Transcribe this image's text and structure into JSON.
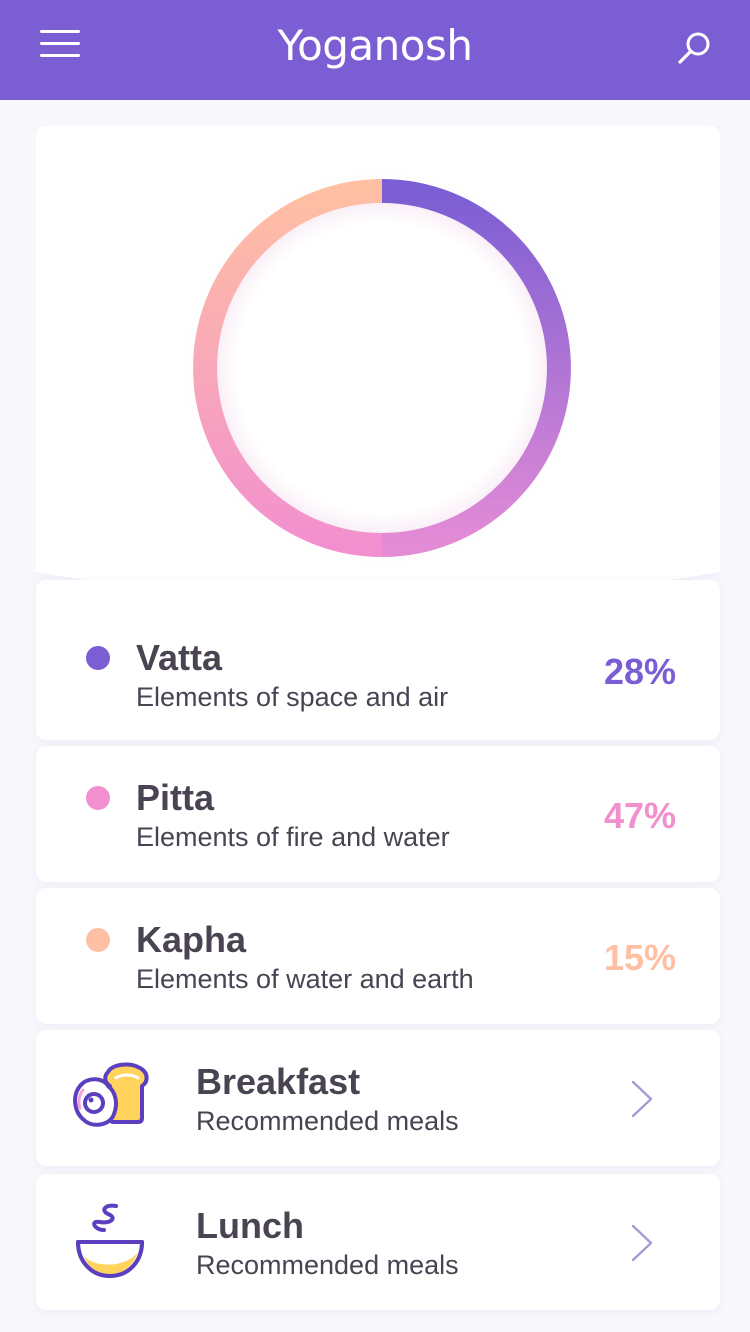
{
  "app": {
    "title": "Yoganosh"
  },
  "icons": {
    "menu": "hamburger-menu-icon",
    "search": "search-icon",
    "chevron": "chevron-right-icon"
  },
  "colors": {
    "brand": "#7b5ed3",
    "vatta": "#7b5ed3",
    "pitta": "#f28fcf",
    "kapha": "#ffbfa3",
    "chevron": "#a59ad6"
  },
  "doshas": [
    {
      "name": "Vatta",
      "description": "Elements of space and air",
      "percent_label": "28%",
      "percent": 28,
      "color": "#7b5ed3"
    },
    {
      "name": "Pitta",
      "description": "Elements of fire and water",
      "percent_label": "47%",
      "percent": 47,
      "color": "#f28fcf"
    },
    {
      "name": "Kapha",
      "description": "Elements of water and earth",
      "percent_label": "15%",
      "percent": 15,
      "color": "#ffbfa3"
    }
  ],
  "meals": [
    {
      "name": "Breakfast",
      "description": "Recommended meals",
      "icon": "breakfast-egg-toast-icon"
    },
    {
      "name": "Lunch",
      "description": "Recommended meals",
      "icon": "lunch-bowl-icon"
    }
  ]
}
